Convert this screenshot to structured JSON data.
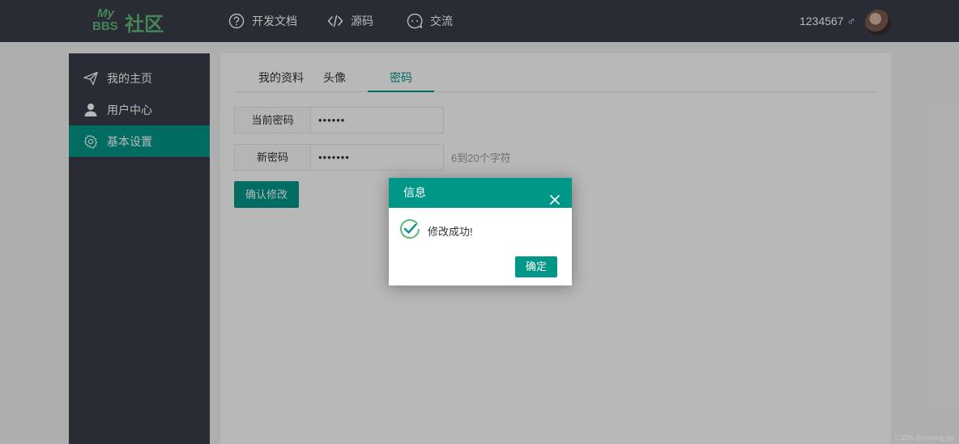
{
  "header": {
    "logo": {
      "my": "My",
      "bbs": "BBS",
      "community": "社区"
    },
    "nav": [
      {
        "label": "开发文档",
        "icon": "help-circle-icon"
      },
      {
        "label": "源码",
        "icon": "code-icon"
      },
      {
        "label": "交流",
        "icon": "chat-icon"
      }
    ],
    "username": "1234567 ♂"
  },
  "sidebar": {
    "items": [
      {
        "label": "我的主页",
        "icon": "paper-plane-icon",
        "active": false
      },
      {
        "label": "用户中心",
        "icon": "user-icon",
        "active": false
      },
      {
        "label": "基本设置",
        "icon": "gear-icon",
        "active": true
      }
    ]
  },
  "main": {
    "tabs": [
      {
        "label": "我的资料",
        "active": false
      },
      {
        "label": "头像",
        "active": false
      },
      {
        "label": "密码",
        "active": true
      }
    ],
    "form": {
      "current_password_label": "当前密码",
      "current_password_value": "••••••",
      "new_password_label": "新密码",
      "new_password_value": "•••••••",
      "new_password_hint": "6到20个字符",
      "submit_label": "确认修改"
    }
  },
  "dialog": {
    "title": "信息",
    "message": "修改成功!",
    "ok_label": "确定",
    "status_icon": "check-circle-icon"
  },
  "watermark": "CSDN @yicixing_go",
  "colors": {
    "header_bg": "#393d49",
    "accent": "#009688",
    "logo_green": "#5fb878"
  }
}
